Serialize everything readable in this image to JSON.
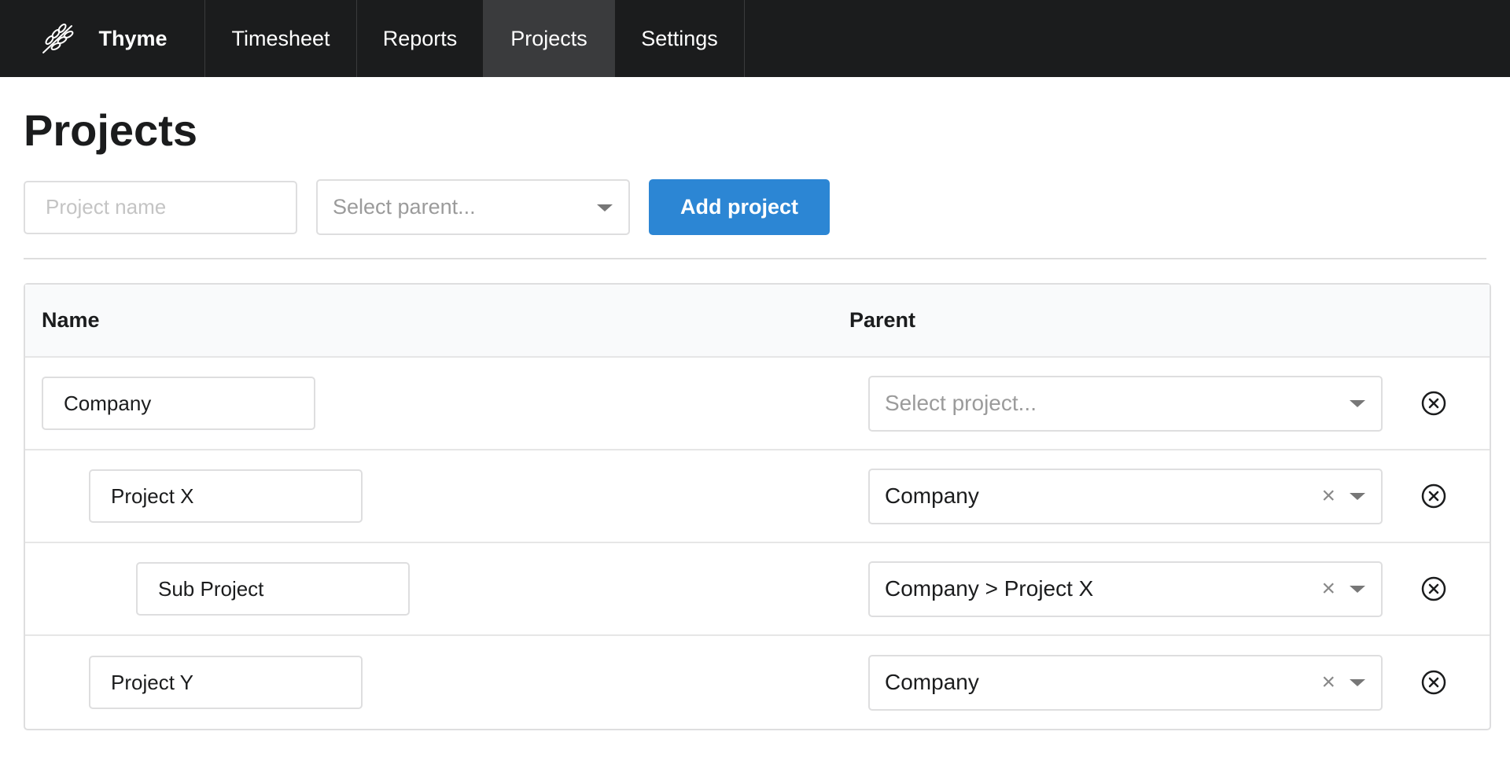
{
  "nav": {
    "brand": "Thyme",
    "tabs": [
      {
        "label": "Timesheet"
      },
      {
        "label": "Reports"
      },
      {
        "label": "Projects"
      },
      {
        "label": "Settings"
      }
    ]
  },
  "page": {
    "title": "Projects"
  },
  "form": {
    "name_placeholder": "Project name",
    "parent_placeholder": "Select parent...",
    "add_label": "Add project"
  },
  "table": {
    "headers": {
      "name": "Name",
      "parent": "Parent"
    },
    "rows": [
      {
        "name": "Company",
        "parent": "",
        "parent_placeholder": "Select project..."
      },
      {
        "name": "Project X",
        "parent": "Company"
      },
      {
        "name": "Sub Project",
        "parent": "Company > Project X"
      },
      {
        "name": "Project Y",
        "parent": "Company"
      }
    ],
    "clear_glyph": "×"
  },
  "colors": {
    "nav_bg": "#1b1c1d",
    "active_tab": "#3a3b3d",
    "primary": "#2c86d4"
  }
}
